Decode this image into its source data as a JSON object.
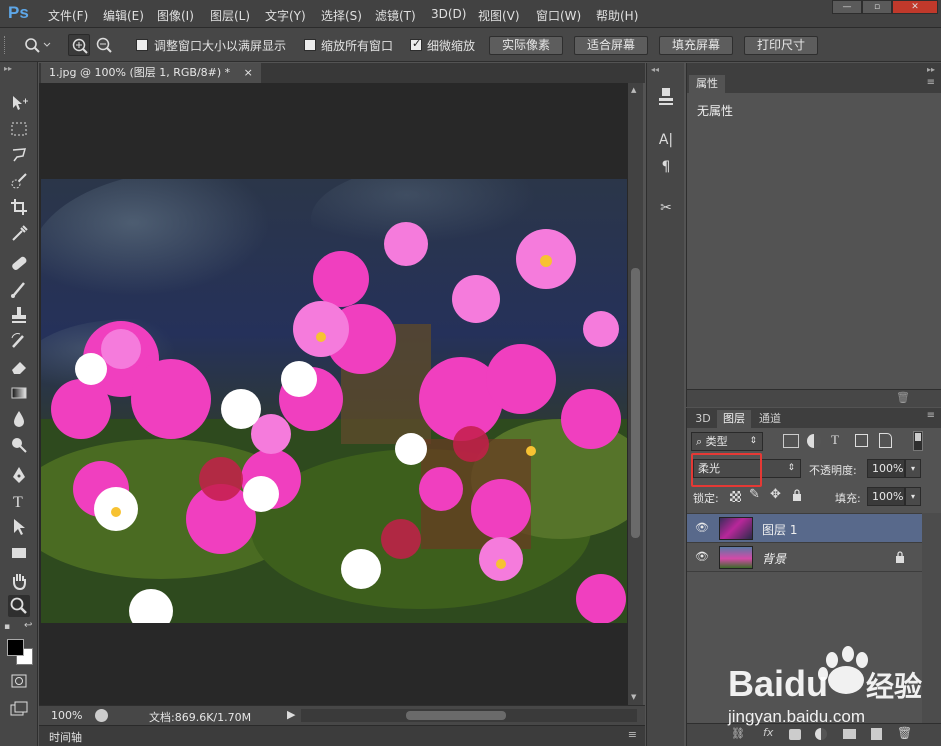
{
  "app": {
    "logo": "Ps"
  },
  "menu": [
    "文件(F)",
    "编辑(E)",
    "图像(I)",
    "图层(L)",
    "文字(Y)",
    "选择(S)",
    "滤镜(T)",
    "3D(D)",
    "视图(V)",
    "窗口(W)",
    "帮助(H)"
  ],
  "window_controls": [
    "minimize",
    "maximize",
    "close"
  ],
  "options": {
    "resize_windows_label": "调整窗口大小以满屏显示",
    "zoom_all_label": "缩放所有窗口",
    "scrubby_zoom_label": "细微缩放",
    "scrubby_zoom_checked": true,
    "actual_pixels": "实际像素",
    "fit_screen": "适合屏幕",
    "fill_screen": "填充屏幕",
    "print_size": "打印尺寸"
  },
  "document": {
    "tab_title": "1.jpg @ 100% (图层 1, RGB/8#) *",
    "close_glyph": "×"
  },
  "status": {
    "zoom": "100%",
    "doc_size": "文档:869.6K/1.70M"
  },
  "timeline": {
    "label": "时间轴"
  },
  "properties": {
    "tab": "属性",
    "content": "无属性"
  },
  "layers": {
    "tabs": [
      "3D",
      "图层",
      "通道"
    ],
    "active_tab": "图层",
    "filter_kind": "类型",
    "blend_mode": "柔光",
    "opacity_label": "不透明度:",
    "opacity_value": "100%",
    "lock_label": "锁定:",
    "fill_label": "填充:",
    "fill_value": "100%",
    "items": [
      {
        "name": "图层 1",
        "selected": true,
        "visible": true
      },
      {
        "name": "背景",
        "selected": false,
        "visible": true,
        "locked": true
      }
    ]
  },
  "watermark": {
    "brand": "Baidu",
    "brand_cn": "经验",
    "url": "jingyan.baidu.com"
  },
  "colors": {
    "ui_dark": "#282828",
    "panel": "#535353",
    "selection": "#58698b",
    "highlight_box": "#e53935"
  }
}
